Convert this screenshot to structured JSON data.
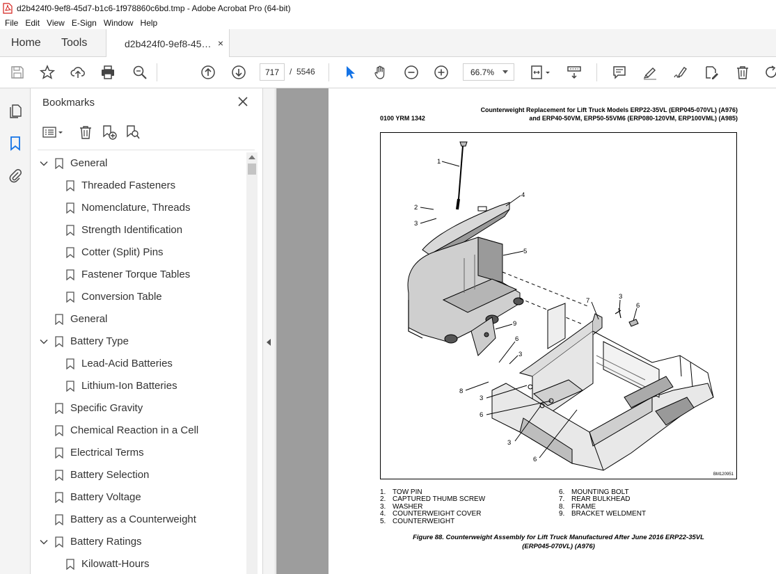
{
  "window": {
    "title": "d2b424f0-9ef8-45d7-b1c6-1f978860c6bd.tmp - Adobe Acrobat Pro (64-bit)"
  },
  "menu": [
    "File",
    "Edit",
    "View",
    "E-Sign",
    "Window",
    "Help"
  ],
  "tabs": {
    "home": "Home",
    "tools": "Tools",
    "document": "d2b424f0-9ef8-45…",
    "close_glyph": "×"
  },
  "toolbar": {
    "current_page": "717",
    "page_separator": "/",
    "total_pages": "5546",
    "zoom": "66.7%",
    "icons": [
      "save-icon",
      "star-icon",
      "upload-icon",
      "print-icon",
      "zoom-search-icon",
      "page-up-icon",
      "page-down-icon",
      "select-cursor-icon",
      "hand-icon",
      "zoom-out-icon",
      "zoom-in-icon",
      "fit-page-icon",
      "scroll-mode-icon",
      "comment-icon",
      "highlight-icon",
      "sign-icon",
      "edit-pdf-icon",
      "delete-icon",
      "rotate-icon"
    ]
  },
  "sidebar": {
    "title": "Bookmarks",
    "close_glyph": "✕"
  },
  "bookmarks": [
    {
      "label": "General",
      "level": 0,
      "expanded": true
    },
    {
      "label": "Threaded Fasteners",
      "level": 1
    },
    {
      "label": "Nomenclature, Threads",
      "level": 1
    },
    {
      "label": "Strength Identification",
      "level": 1
    },
    {
      "label": "Cotter (Split) Pins",
      "level": 1
    },
    {
      "label": "Fastener Torque Tables",
      "level": 1
    },
    {
      "label": "Conversion Table",
      "level": 1
    },
    {
      "label": "General",
      "level": 0
    },
    {
      "label": "Battery Type",
      "level": 0,
      "expanded": true
    },
    {
      "label": "Lead-Acid Batteries",
      "level": 1
    },
    {
      "label": "Lithium-Ion Batteries",
      "level": 1
    },
    {
      "label": "Specific Gravity",
      "level": 0
    },
    {
      "label": "Chemical Reaction in a Cell",
      "level": 0
    },
    {
      "label": "Electrical Terms",
      "level": 0
    },
    {
      "label": "Battery Selection",
      "level": 0
    },
    {
      "label": "Battery Voltage",
      "level": 0
    },
    {
      "label": "Battery as a Counterweight",
      "level": 0
    },
    {
      "label": "Battery Ratings",
      "level": 0,
      "expanded": true
    },
    {
      "label": "Kilowatt-Hours",
      "level": 1
    }
  ],
  "document": {
    "header_left": "0100 YRM 1342",
    "header_right_line1": "Counterweight Replacement for Lift Truck Models ERP22-35VL (ERP045-070VL) (A976)",
    "header_right_line2": "and ERP40-50VM, ERP50-55VM6 (ERP080-120VM, ERP100VML) (A985)",
    "figure_id": "BM120951",
    "callouts": [
      "1",
      "2",
      "3",
      "4",
      "5",
      "7",
      "3",
      "6",
      "9",
      "6",
      "3",
      "8",
      "3",
      "6",
      "3",
      "6"
    ],
    "legend_col1": [
      {
        "num": "1.",
        "text": "TOW PIN"
      },
      {
        "num": "2.",
        "text": "CAPTURED THUMB SCREW"
      },
      {
        "num": "3.",
        "text": "WASHER"
      },
      {
        "num": "4.",
        "text": "COUNTERWEIGHT COVER"
      },
      {
        "num": "5.",
        "text": "COUNTERWEIGHT"
      }
    ],
    "legend_col2": [
      {
        "num": "6.",
        "text": "MOUNTING BOLT"
      },
      {
        "num": "7.",
        "text": "REAR BULKHEAD"
      },
      {
        "num": "8.",
        "text": "FRAME"
      },
      {
        "num": "9.",
        "text": "BRACKET WELDMENT"
      }
    ],
    "caption_line1": "Figure 88. Counterweight Assembly for Lift Truck Manufactured After June 2016 ERP22-35VL",
    "caption_line2": "(ERP045-070VL) (A976)"
  },
  "colors": {
    "accent": "#1473e6",
    "pdf_red": "#d4211c",
    "doc_background": "#9d9d9d"
  }
}
